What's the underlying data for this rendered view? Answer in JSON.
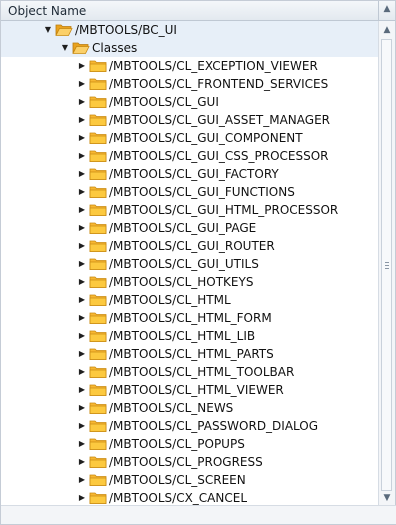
{
  "header": {
    "column_title": "Object Name"
  },
  "scrollbar": {
    "up_arrow": "▲",
    "down_arrow": "▼",
    "header_arrow": "▲"
  },
  "tree": {
    "package": {
      "label": "/MBTOOLS/BC_UI",
      "icon": "folder-open-icon",
      "expanded": true
    },
    "classes_node": {
      "label": "Classes",
      "icon": "folder-open-icon",
      "expanded": true
    },
    "items": [
      {
        "label": "/MBTOOLS/CL_EXCEPTION_VIEWER"
      },
      {
        "label": "/MBTOOLS/CL_FRONTEND_SERVICES"
      },
      {
        "label": "/MBTOOLS/CL_GUI"
      },
      {
        "label": "/MBTOOLS/CL_GUI_ASSET_MANAGER"
      },
      {
        "label": "/MBTOOLS/CL_GUI_COMPONENT"
      },
      {
        "label": "/MBTOOLS/CL_GUI_CSS_PROCESSOR"
      },
      {
        "label": "/MBTOOLS/CL_GUI_FACTORY"
      },
      {
        "label": "/MBTOOLS/CL_GUI_FUNCTIONS"
      },
      {
        "label": "/MBTOOLS/CL_GUI_HTML_PROCESSOR"
      },
      {
        "label": "/MBTOOLS/CL_GUI_PAGE"
      },
      {
        "label": "/MBTOOLS/CL_GUI_ROUTER"
      },
      {
        "label": "/MBTOOLS/CL_GUI_UTILS"
      },
      {
        "label": "/MBTOOLS/CL_HOTKEYS"
      },
      {
        "label": "/MBTOOLS/CL_HTML"
      },
      {
        "label": "/MBTOOLS/CL_HTML_FORM"
      },
      {
        "label": "/MBTOOLS/CL_HTML_LIB"
      },
      {
        "label": "/MBTOOLS/CL_HTML_PARTS"
      },
      {
        "label": "/MBTOOLS/CL_HTML_TOOLBAR"
      },
      {
        "label": "/MBTOOLS/CL_HTML_VIEWER"
      },
      {
        "label": "/MBTOOLS/CL_NEWS"
      },
      {
        "label": "/MBTOOLS/CL_PASSWORD_DIALOG"
      },
      {
        "label": "/MBTOOLS/CL_POPUPS"
      },
      {
        "label": "/MBTOOLS/CL_PROGRESS"
      },
      {
        "label": "/MBTOOLS/CL_SCREEN"
      },
      {
        "label": "/MBTOOLS/CX_CANCEL"
      }
    ]
  },
  "colors": {
    "folder_fill": "#f7b731",
    "folder_stroke": "#c98a12",
    "selected_row": "#e7eff8",
    "header_bg": "#e3e9ef"
  }
}
